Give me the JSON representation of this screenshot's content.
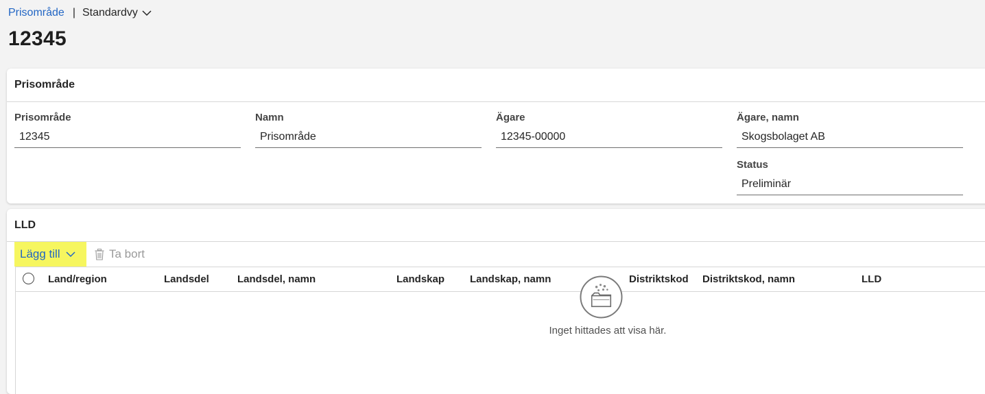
{
  "breadcrumb": {
    "link": "Prisområde",
    "separator": "|",
    "view": "Standardvy"
  },
  "page_title": "12345",
  "general_section": {
    "title": "Prisområde",
    "fields": {
      "prisomrade": {
        "label": "Prisområde",
        "value": "12345"
      },
      "namn": {
        "label": "Namn",
        "value": "Prisområde"
      },
      "agare": {
        "label": "Ägare",
        "value": "12345-00000"
      },
      "agare_namn": {
        "label": "Ägare, namn",
        "value": "Skogsbolaget AB"
      },
      "status": {
        "label": "Status",
        "value": "Preliminär"
      }
    }
  },
  "lld_section": {
    "title": "LLD",
    "toolbar": {
      "add_label": "Lägg till",
      "delete_label": "Ta bort"
    },
    "columns": [
      "Land/region",
      "Landsdel",
      "Landsdel, namn",
      "Landskap",
      "Landskap, namn",
      "Distriktskod",
      "Distriktskod, namn",
      "LLD"
    ],
    "empty_message": "Inget hittades att visa här.",
    "empty_icon": "empty-folder-icon"
  },
  "colors": {
    "link": "#2266c4",
    "highlight": "#f6f65f",
    "background": "#f3f3f3"
  }
}
